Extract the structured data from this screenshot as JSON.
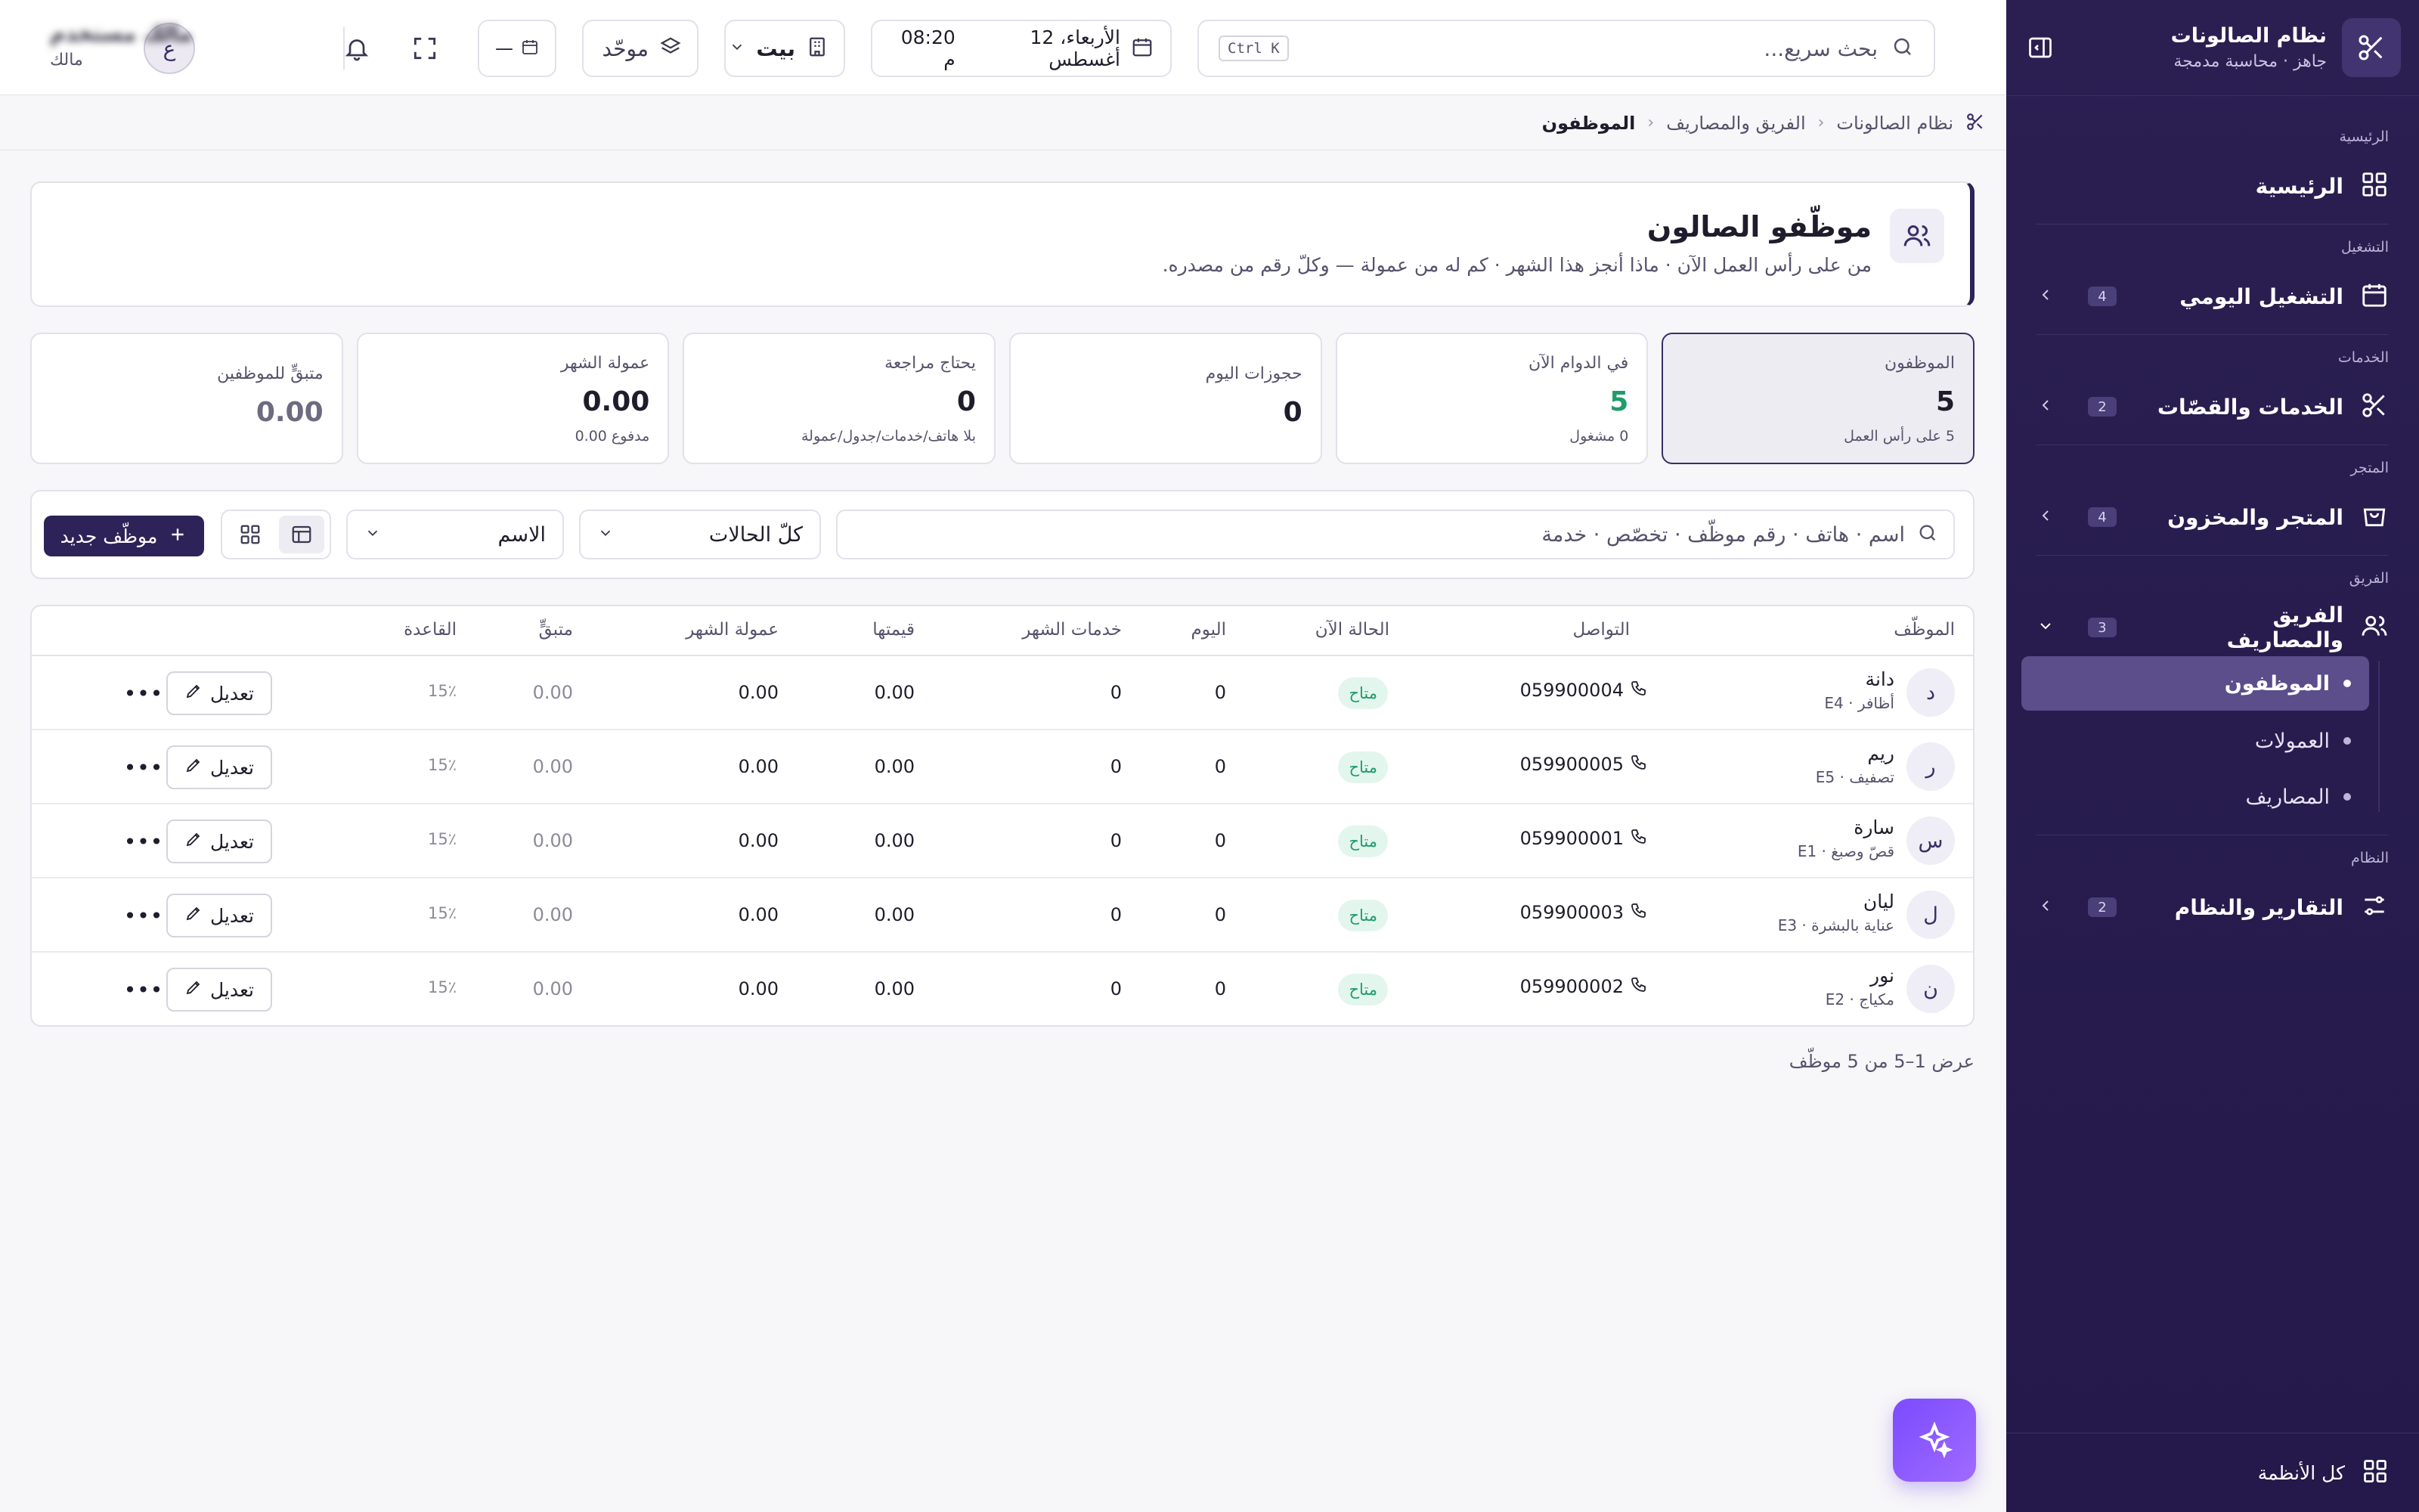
{
  "sidebar": {
    "brand_title": "نظام الصالونات",
    "brand_subtitle": "جاهز · محاسبة مدمجة",
    "sections": {
      "home": "الرئيسية",
      "operations": "التشغيل",
      "services": "الخدمات",
      "store": "المتجر",
      "team": "الفريق",
      "system": "النظام"
    },
    "items": {
      "home": "الرئيسية",
      "daily_ops": {
        "label": "التشغيل اليومي",
        "badge": "4"
      },
      "services": {
        "label": "الخدمات والقصّات",
        "badge": "2"
      },
      "store": {
        "label": "المتجر والمخزون",
        "badge": "4"
      },
      "team": {
        "label": "الفريق والمصاريف",
        "badge": "3"
      },
      "reports": {
        "label": "التقارير والنظام",
        "badge": "2"
      }
    },
    "team_sub": [
      "الموظفون",
      "العمولات",
      "المصاريف"
    ],
    "footer": "كل الأنظمة"
  },
  "topbar": {
    "search_placeholder": "بحث سريع...",
    "shortcut": "Ctrl K",
    "date": "الأربعاء، 12 أغسطس",
    "time": "08:20 م",
    "branch": "بيت",
    "unified": "موحّد",
    "mini": "—",
    "avatar_initial": "ع",
    "user_name": "مالك مستخدم",
    "user_role": "مالك"
  },
  "breadcrumb": [
    "نظام الصالونات",
    "الفريق والمصاريف",
    "الموظفون"
  ],
  "header": {
    "title": "موظّفو الصالون",
    "subtitle": "من على رأس العمل الآن · ماذا أنجز هذا الشهر · كم له من عمولة — وكلّ رقم من مصدره."
  },
  "kpis": [
    {
      "label": "الموظفون",
      "value": "5",
      "sub": "5 على رأس العمل"
    },
    {
      "label": "في الدوام الآن",
      "value": "5",
      "sub": "0 مشغول"
    },
    {
      "label": "حجوزات اليوم",
      "value": "0",
      "sub": ""
    },
    {
      "label": "يحتاج مراجعة",
      "value": "0",
      "sub": "بلا هاتف/خدمات/جدول/عمولة"
    },
    {
      "label": "عمولة الشهر",
      "value": "0.00",
      "sub": "مدفوع 0.00"
    },
    {
      "label": "متبقٍّ للموظفين",
      "value": "0.00",
      "sub": ""
    }
  ],
  "filters": {
    "search_placeholder": "اسم · هاتف · رقم موظّف · تخصّص · خدمة",
    "status": "كلّ الحالات",
    "sort": "الاسم",
    "new_button": "موظّف جديد"
  },
  "table": {
    "headers": {
      "employee": "الموظّف",
      "contact": "التواصل",
      "status": "الحالة الآن",
      "today": "اليوم",
      "month_services": "خدمات الشهر",
      "value": "قيمتها",
      "month_commission": "عمولة الشهر",
      "remaining": "متبقٍّ",
      "base": "القاعدة"
    },
    "edit_label": "تعديل",
    "more_label": "•••",
    "rows": [
      {
        "initial": "د",
        "name": "دانة",
        "meta": "أظافر · E4",
        "phone": "059900004",
        "status": "متاح",
        "today": "0",
        "services": "0",
        "value": "0.00",
        "commission": "0.00",
        "remaining": "0.00",
        "base": "15٪"
      },
      {
        "initial": "ر",
        "name": "ريم",
        "meta": "تصفيف · E5",
        "phone": "059900005",
        "status": "متاح",
        "today": "0",
        "services": "0",
        "value": "0.00",
        "commission": "0.00",
        "remaining": "0.00",
        "base": "15٪"
      },
      {
        "initial": "س",
        "name": "سارة",
        "meta": "قصّ وصبغ · E1",
        "phone": "059900001",
        "status": "متاح",
        "today": "0",
        "services": "0",
        "value": "0.00",
        "commission": "0.00",
        "remaining": "0.00",
        "base": "15٪"
      },
      {
        "initial": "ل",
        "name": "ليان",
        "meta": "عناية بالبشرة · E3",
        "phone": "059900003",
        "status": "متاح",
        "today": "0",
        "services": "0",
        "value": "0.00",
        "commission": "0.00",
        "remaining": "0.00",
        "base": "15٪"
      },
      {
        "initial": "ن",
        "name": "نور",
        "meta": "مكياج · E2",
        "phone": "059900002",
        "status": "متاح",
        "today": "0",
        "services": "0",
        "value": "0.00",
        "commission": "0.00",
        "remaining": "0.00",
        "base": "15٪"
      }
    ]
  },
  "footer_count": "عرض 1–5 من 5 موظّف",
  "colors": {
    "sidebar": "#2b1f52",
    "accent": "#2d2358",
    "success": "#1f9d6a",
    "fab": "#8a5cff"
  }
}
